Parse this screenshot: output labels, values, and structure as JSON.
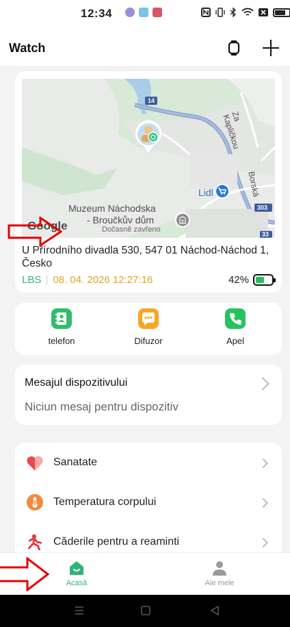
{
  "status_bar": {
    "time": "12:34",
    "icons": [
      "nfc-icon",
      "vibrate-icon",
      "bluetooth-icon",
      "wifi-icon",
      "close-box-icon",
      "battery-icon"
    ]
  },
  "header": {
    "title": "Watch",
    "icons": [
      "watch-icon",
      "plus-icon"
    ]
  },
  "map": {
    "road_number_1": "14",
    "road_number_2": "303",
    "road_number_3": "33",
    "street_1": "Za Kapličkou",
    "street_2": "Borská",
    "poi_lidl": "Lidl",
    "poi_museum_line1": "Muzeum Náchodska",
    "poi_museum_line2": "- Broučkův dům",
    "poi_museum_status": "Dočasně zavřeno",
    "google_logo": "Google"
  },
  "location": {
    "address": "U Přírodního divadla 530, 547 01 Náchod-Náchod 1, Česko",
    "source": "LBS",
    "timestamp": "08. 04. 2026 12:27:16",
    "battery": "42%",
    "battery_level": 0.42
  },
  "actions": [
    {
      "label": "telefon",
      "icon": "contacts-icon",
      "color": "#2fbf6a"
    },
    {
      "label": "Difuzor",
      "icon": "chat-bubble-icon",
      "color": "#f6a623"
    },
    {
      "label": "Apel",
      "icon": "phone-icon",
      "color": "#27c260"
    }
  ],
  "device_message": {
    "title": "Mesajul dispozitivului",
    "subtitle": "Niciun mesaj pentru dispozitiv"
  },
  "features": [
    {
      "label": "Sanatate",
      "icon": "heart-icon"
    },
    {
      "label": "Temperatura corpului",
      "icon": "thermometer-icon"
    },
    {
      "label": "Căderile pentru a reaminti",
      "icon": "fall-icon"
    }
  ],
  "tabs": [
    {
      "label": "Acasă",
      "icon": "home-icon",
      "active": true
    },
    {
      "label": "Ale mele",
      "icon": "person-icon",
      "active": false
    }
  ],
  "nav_bar": {
    "icons": [
      "menu-icon",
      "home-square-icon",
      "back-icon"
    ]
  },
  "colors": {
    "accent_green": "#2eb57a",
    "timestamp_orange": "#e0a32a",
    "annotation_red": "#e60000"
  }
}
